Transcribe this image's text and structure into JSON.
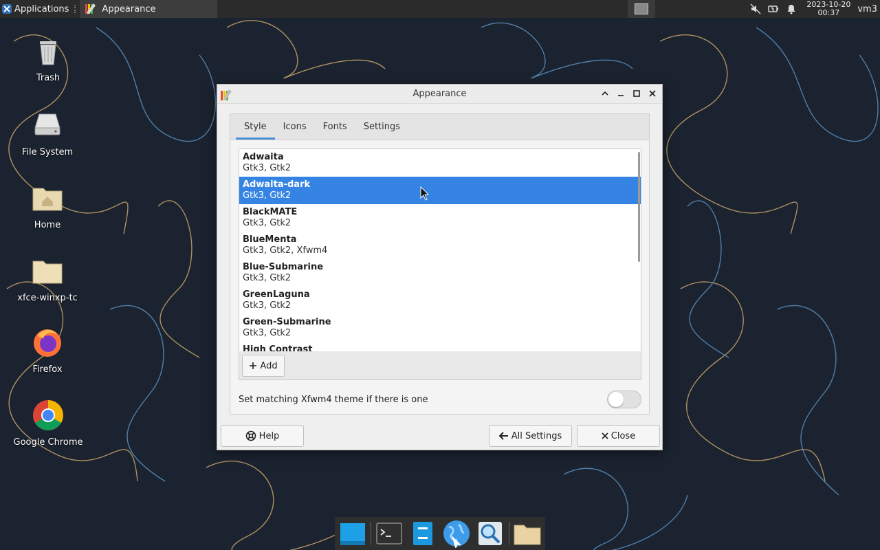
{
  "panel": {
    "applications_label": "Applications",
    "task_title": "Appearance",
    "clock_date": "2023-10-20",
    "clock_time": "00:37",
    "user": "vm3"
  },
  "desktop": {
    "icons": [
      {
        "label": "Trash"
      },
      {
        "label": "File System"
      },
      {
        "label": "Home"
      },
      {
        "label": "xfce-winxp-tc"
      },
      {
        "label": "Firefox"
      },
      {
        "label": "Google Chrome"
      }
    ]
  },
  "dialog": {
    "title": "Appearance",
    "tabs": [
      {
        "label": "Style"
      },
      {
        "label": "Icons"
      },
      {
        "label": "Fonts"
      },
      {
        "label": "Settings"
      }
    ],
    "themes": [
      {
        "name": "Adwaita",
        "desc": "Gtk3, Gtk2"
      },
      {
        "name": "Adwaita-dark",
        "desc": "Gtk3, Gtk2"
      },
      {
        "name": "BlackMATE",
        "desc": "Gtk3, Gtk2"
      },
      {
        "name": "BlueMenta",
        "desc": "Gtk3, Gtk2, Xfwm4"
      },
      {
        "name": "Blue-Submarine",
        "desc": "Gtk3, Gtk2"
      },
      {
        "name": "GreenLaguna",
        "desc": "Gtk3, Gtk2"
      },
      {
        "name": "Green-Submarine",
        "desc": "Gtk3, Gtk2"
      },
      {
        "name": "High Contrast",
        "desc": ""
      }
    ],
    "selected_theme": "Adwaita-dark",
    "add_label": "Add",
    "match_label": "Set matching Xfwm4 theme if there is one",
    "match_enabled": false,
    "help_label": "Help",
    "all_settings_label": "All Settings",
    "close_label": "Close"
  },
  "colors": {
    "selection": "#3584e4",
    "tab_indicator": "#4a90d9"
  }
}
